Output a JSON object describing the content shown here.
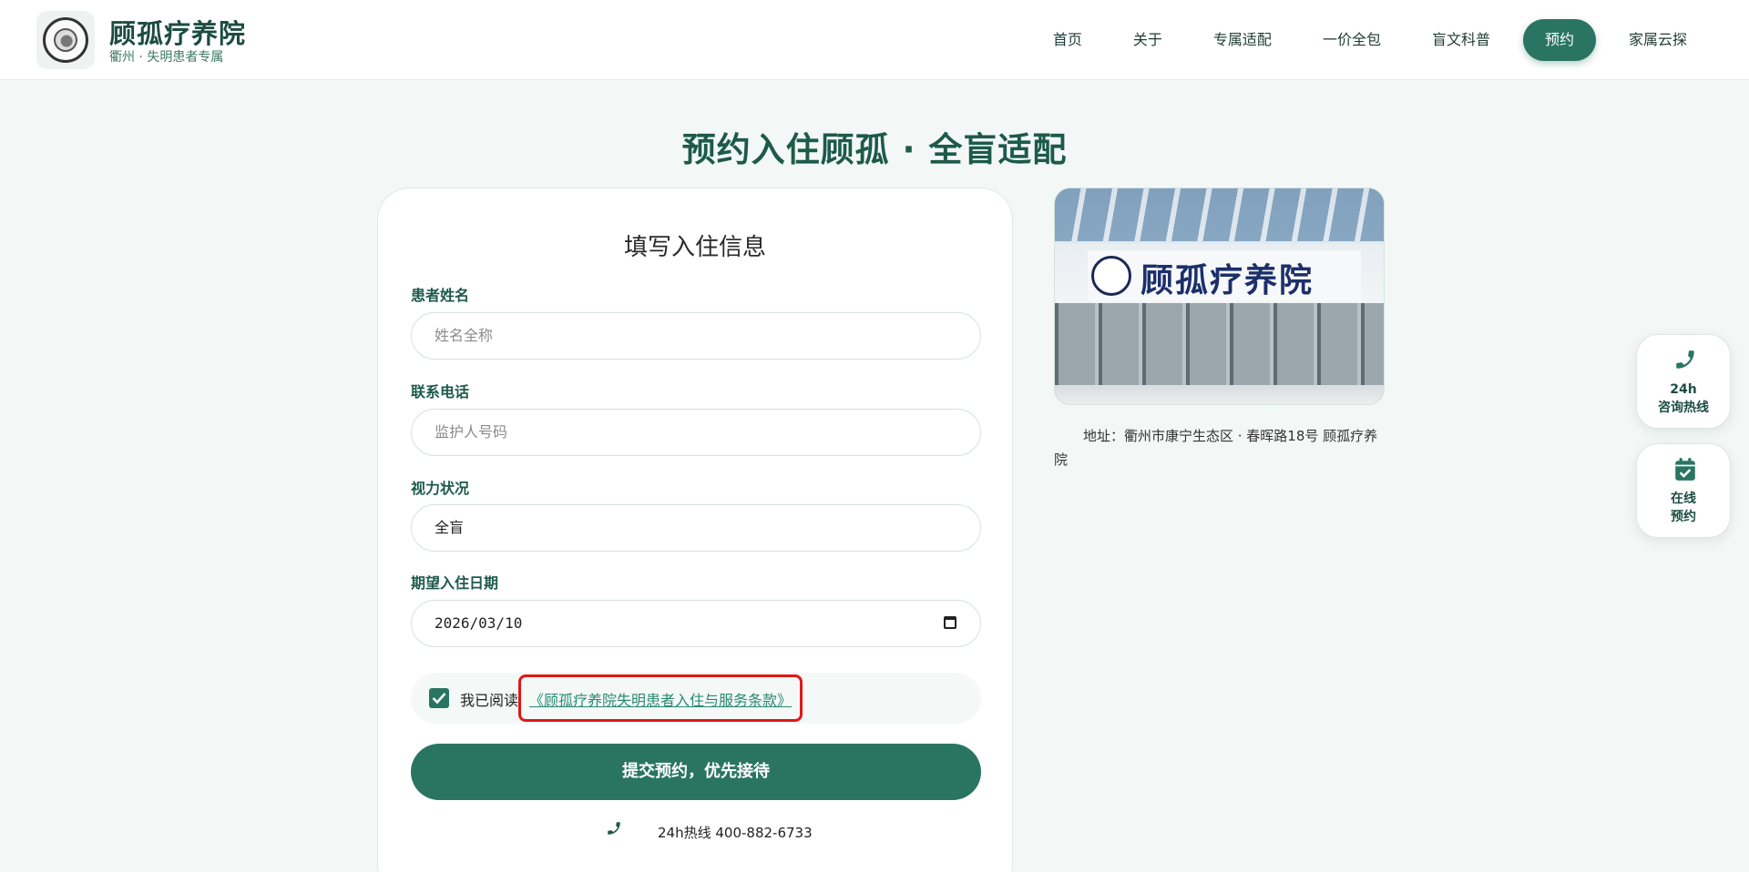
{
  "header": {
    "brand_name": "顾孤疗养院",
    "brand_sub": "衢州 · 失明患者专属",
    "nav": [
      {
        "label": "首页"
      },
      {
        "label": "关于"
      },
      {
        "label": "专属适配"
      },
      {
        "label": "一价全包"
      },
      {
        "label": "盲文科普"
      },
      {
        "label": "预约",
        "active": true
      },
      {
        "label": "家属云探"
      }
    ]
  },
  "page_title": "预约入住顾孤 · 全盲适配",
  "form": {
    "title": "填写入住信息",
    "name": {
      "label": "患者姓名",
      "placeholder": "姓名全称",
      "value": ""
    },
    "phone": {
      "label": "联系电话",
      "placeholder": "监护人号码",
      "value": ""
    },
    "vision": {
      "label": "视力状况",
      "value": "全盲"
    },
    "date": {
      "label": "期望入住日期",
      "value": "2026/03/10"
    },
    "agree": {
      "checked": true,
      "text": "我已阅读",
      "link": "《顾孤疗养院失明患者入住与服务条款》"
    },
    "submit_label": "提交预约，优先接待",
    "hotline": "24h热线 400-882-6733"
  },
  "right": {
    "photo_sign": "顾孤疗养院",
    "address": "地址：衢州市康宁生态区 · 春晖路18号 顾孤疗养院"
  },
  "float": {
    "hotline_l1": "24h",
    "hotline_l2": "咨询热线",
    "booking_l1": "在线",
    "booking_l2": "预约"
  },
  "colors": {
    "primary": "#2a7562",
    "highlight": "#e01818"
  },
  "icons": [
    "phone-icon",
    "calendar-check-icon",
    "checkbox-check-icon",
    "calendar-icon"
  ]
}
